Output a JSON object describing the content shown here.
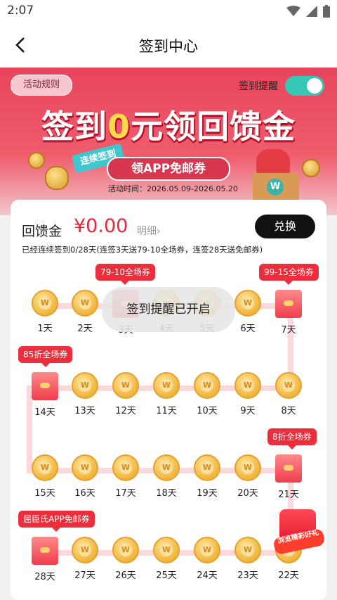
{
  "status_bar": {
    "time": "2:07"
  },
  "nav": {
    "title": "签到中心"
  },
  "hero": {
    "rules_button": "活动规则",
    "remind_label": "签到提醒",
    "remind_on": true,
    "title_pre": "签到",
    "title_zero": "0",
    "title_post": "元领回馈金",
    "streak_tag": "连续签到",
    "pill": "领APP免邮券",
    "period": "活动时间：2026.05.09-2026.05.20"
  },
  "card": {
    "balance_label": "回馈金",
    "balance_amount": "¥0.00",
    "detail_link": "明细",
    "redeem_button": "兑换",
    "progress_text": "已经连续签到0/28天(连签3天送79-10全场券，连签28天送免邮券)"
  },
  "rows": [
    [
      {
        "label": "1天",
        "type": "coin"
      },
      {
        "label": "2天",
        "type": "coin"
      },
      {
        "label": "3天",
        "type": "envelope"
      },
      {
        "label": "4天",
        "type": "coin"
      },
      {
        "label": "5天",
        "type": "coin"
      },
      {
        "label": "6天",
        "type": "coin"
      },
      {
        "label": "7天",
        "type": "envelope"
      }
    ],
    [
      {
        "label": "14天",
        "type": "envelope"
      },
      {
        "label": "13天",
        "type": "coin"
      },
      {
        "label": "12天",
        "type": "coin"
      },
      {
        "label": "11天",
        "type": "coin"
      },
      {
        "label": "10天",
        "type": "coin"
      },
      {
        "label": "9天",
        "type": "coin"
      },
      {
        "label": "8天",
        "type": "coin"
      }
    ],
    [
      {
        "label": "15天",
        "type": "coin"
      },
      {
        "label": "16天",
        "type": "coin"
      },
      {
        "label": "17天",
        "type": "coin"
      },
      {
        "label": "18天",
        "type": "coin"
      },
      {
        "label": "19天",
        "type": "coin"
      },
      {
        "label": "20天",
        "type": "coin"
      },
      {
        "label": "21天",
        "type": "envelope"
      }
    ],
    [
      {
        "label": "28天",
        "type": "envelope"
      },
      {
        "label": "27天",
        "type": "coin"
      },
      {
        "label": "26天",
        "type": "coin"
      },
      {
        "label": "25天",
        "type": "coin"
      },
      {
        "label": "24天",
        "type": "coin"
      },
      {
        "label": "23天",
        "type": "coin"
      },
      {
        "label": "22天",
        "type": "coin"
      }
    ]
  ],
  "badges": {
    "day3": "79-10全场券",
    "day7": "99-15全场券",
    "day14": "85折全场券",
    "day21": "8折全场券",
    "day28": "屈臣氏APP免邮券"
  },
  "toast": "签到提醒已开启",
  "float_badge": "浏览精彩好礼",
  "colors": {
    "primary_red": "#e6273b",
    "toggle_on": "#35c9b5",
    "hero_bg": "#e8445c"
  }
}
